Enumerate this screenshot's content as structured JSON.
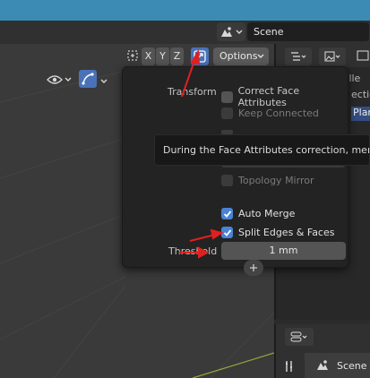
{
  "header": {
    "scene_label": "Scene"
  },
  "viewport_header": {
    "axes": [
      "X",
      "Y",
      "Z"
    ],
    "options_label": "Options"
  },
  "popover": {
    "transform_label": "Transform",
    "items": [
      {
        "label": "Correct Face Attributes",
        "checked": false,
        "enabled": true
      },
      {
        "label": "Keep Connected",
        "checked": false,
        "enabled": false
      },
      {
        "label": "Topology Mirror",
        "checked": false,
        "enabled": false
      },
      {
        "label": "Auto Merge",
        "checked": true,
        "enabled": true
      },
      {
        "label": "Split Edges & Faces",
        "checked": true,
        "enabled": true
      }
    ],
    "threshold_label": "Threshold",
    "threshold_value": "1 mm"
  },
  "tooltip": {
    "text": "During the Face Attributes correction, merge a"
  },
  "outliner": {
    "partial_texts": [
      "Scene Colle",
      "ectio",
      "Plan"
    ]
  },
  "properties": {
    "scene_label": "Scene"
  },
  "colors": {
    "accent": "#4a83d4",
    "topbar": "#3c8bb4",
    "annotation": "#e02020"
  }
}
